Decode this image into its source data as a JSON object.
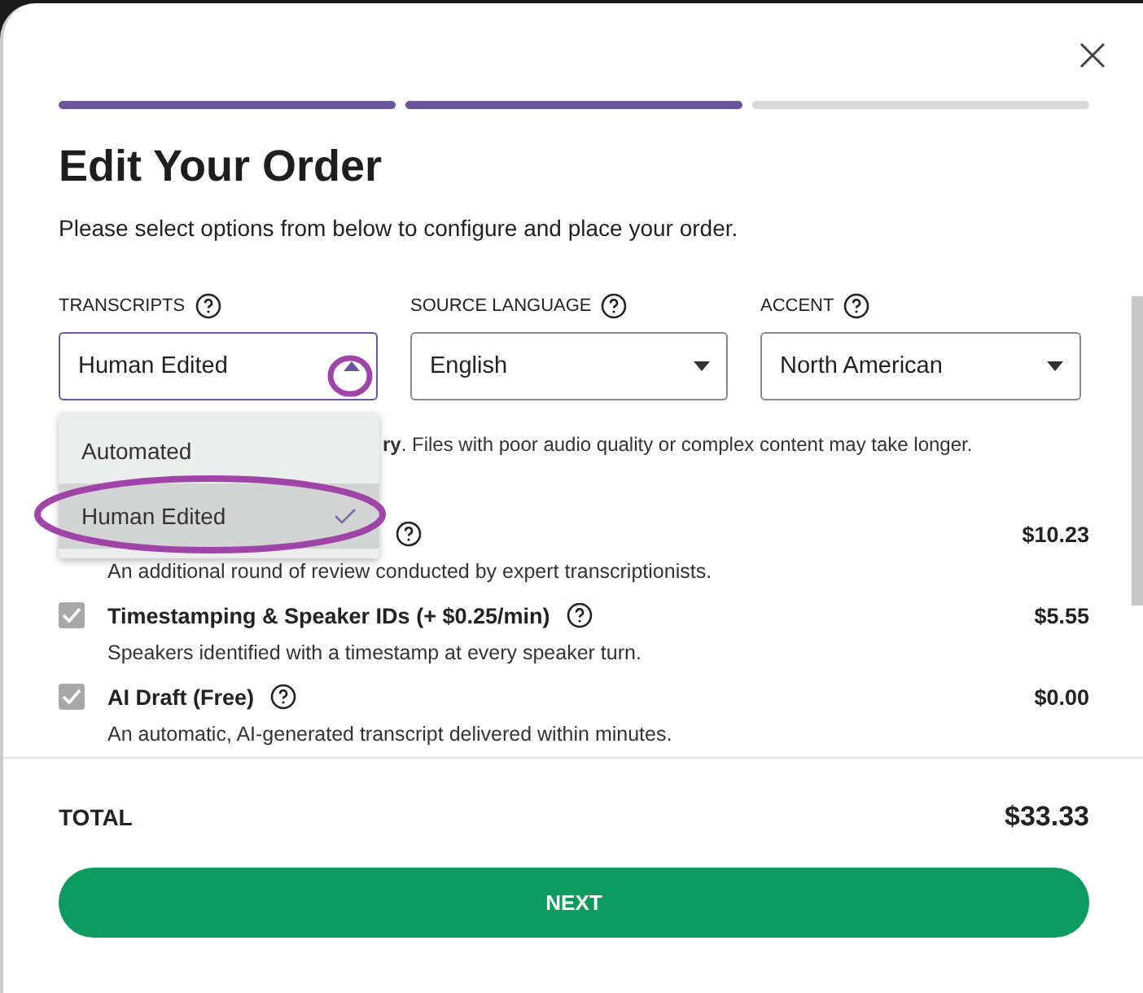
{
  "progress": [
    {
      "done": true
    },
    {
      "done": true
    },
    {
      "done": false
    }
  ],
  "title": "Edit Your Order",
  "subtitle": "Please select options from below to configure and place your order.",
  "fields": [
    {
      "label": "TRANSCRIPTS",
      "value": "Human Edited",
      "expanded": true
    },
    {
      "label": "SOURCE LANGUAGE",
      "value": "English",
      "expanded": false
    },
    {
      "label": "ACCENT",
      "value": "North American",
      "expanded": false
    }
  ],
  "dropdown_options": [
    {
      "label": "Automated",
      "selected": false
    },
    {
      "label": "Human Edited",
      "selected": true
    }
  ],
  "notice": "**ry**. Files with poor audio quality or complex content may take longer.",
  "addons": [
    {
      "price": "$10.23",
      "description": "An additional round of review conducted by expert transcriptionists."
    },
    {
      "title": "Timestamping & Speaker IDs (+ $0.25/min)",
      "checked": true,
      "price": "$5.55",
      "description": "Speakers identified with a timestamp at every speaker turn."
    },
    {
      "title": "AI Draft (Free)",
      "checked": true,
      "price": "$0.00",
      "description": "An automatic, AI-generated transcript delivered within minutes."
    }
  ],
  "total": {
    "label": "TOTAL",
    "value": "$33.33"
  },
  "next_button": "NEXT"
}
